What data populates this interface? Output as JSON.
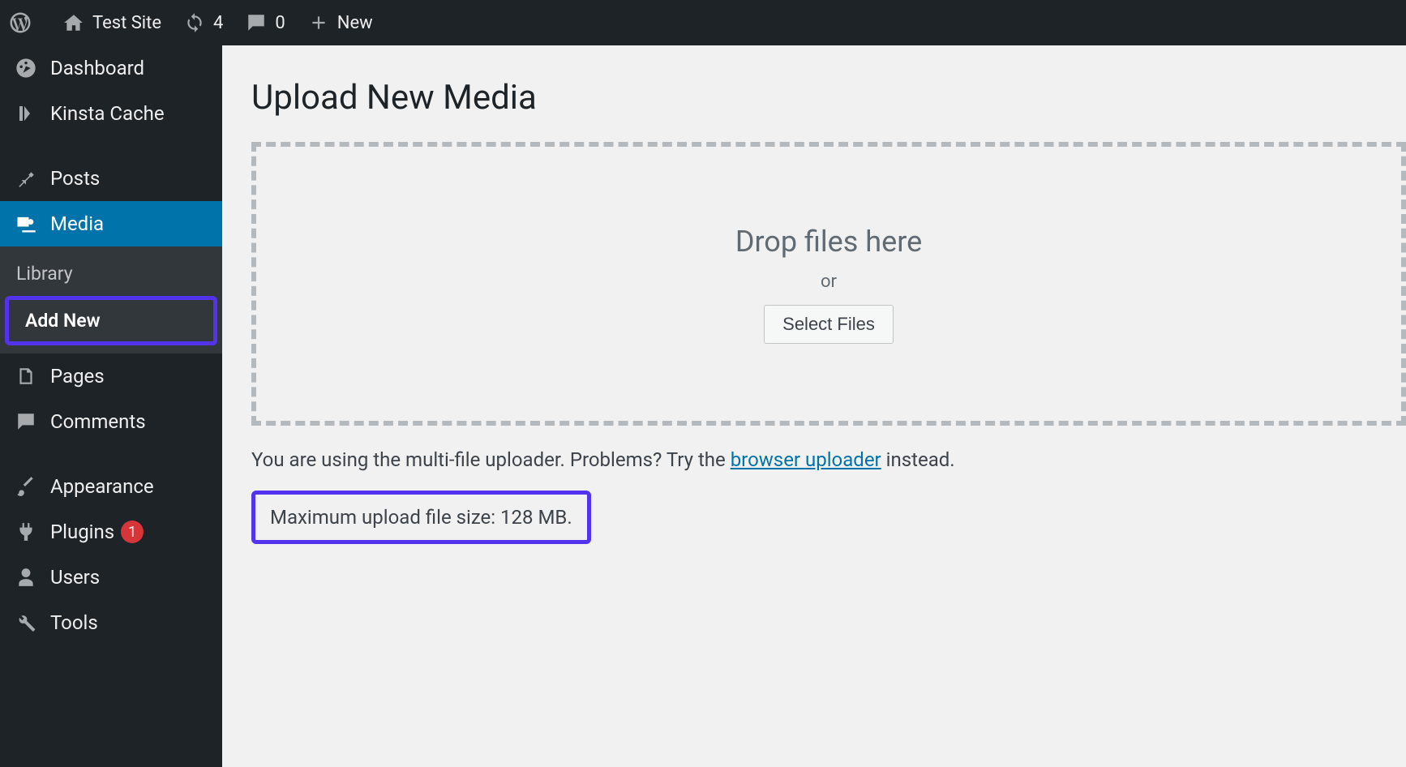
{
  "topbar": {
    "site_name": "Test Site",
    "updates_count": "4",
    "comments_count": "0",
    "new_label": "New"
  },
  "sidebar": {
    "dashboard": "Dashboard",
    "kinsta": "Kinsta Cache",
    "posts": "Posts",
    "media": "Media",
    "media_sub": {
      "library": "Library",
      "add_new": "Add New"
    },
    "pages": "Pages",
    "comments": "Comments",
    "appearance": "Appearance",
    "plugins": "Plugins",
    "plugins_count": "1",
    "users": "Users",
    "tools": "Tools"
  },
  "main": {
    "title": "Upload New Media",
    "drop_text": "Drop files here",
    "or_text": "or",
    "select_btn": "Select Files",
    "info_prefix": "You are using the multi-file uploader. Problems? Try the ",
    "info_link": "browser uploader",
    "info_suffix": " instead.",
    "max_size": "Maximum upload file size: 128 MB."
  }
}
